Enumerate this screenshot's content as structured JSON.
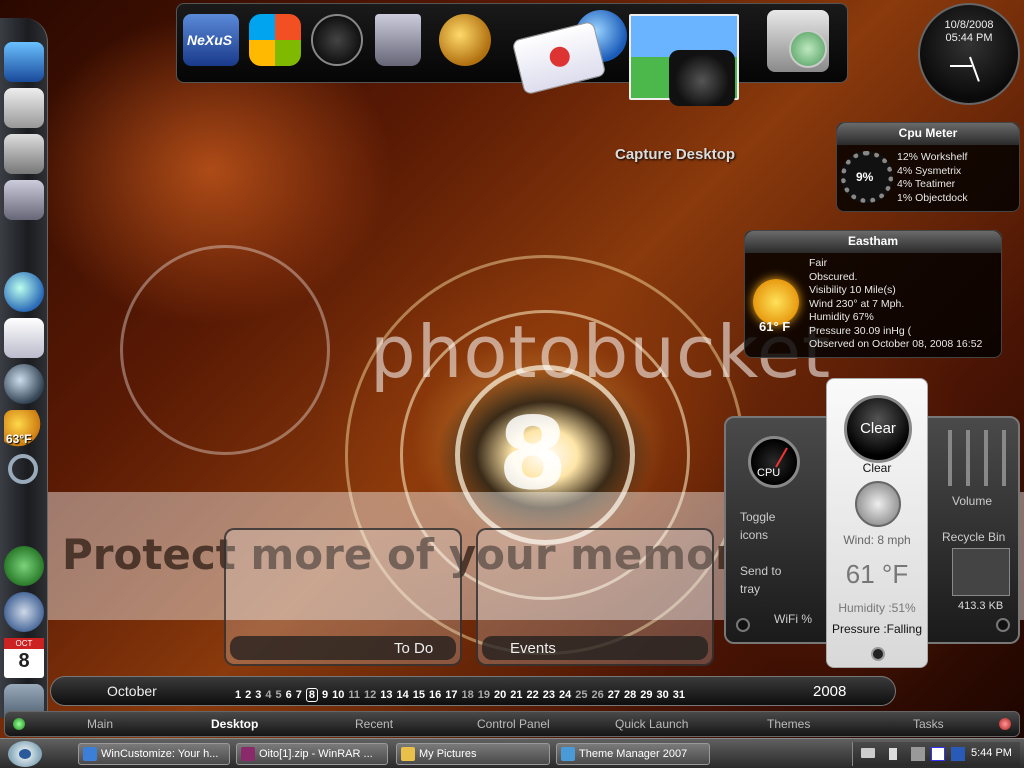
{
  "wallpaper": {
    "center_numeral": "8"
  },
  "watermark": {
    "logo": "photobucket",
    "banner": "Protect more of your memories for less!"
  },
  "top_dock": {
    "icons": [
      {
        "name": "nexus-logo-icon",
        "label": "NeXuS"
      },
      {
        "name": "windows-flag-icon"
      },
      {
        "name": "clock-icon"
      },
      {
        "name": "recycle-bin-icon"
      },
      {
        "name": "globe-network-icon"
      },
      {
        "name": "internet-explorer-icon"
      },
      {
        "name": "mail-envelope-icon"
      },
      {
        "name": "camera-capture-icon"
      },
      {
        "name": "monitor-clock-icon"
      }
    ],
    "hover_label": "Capture Desktop"
  },
  "clock": {
    "date": "10/8/2008",
    "time": "05:44 PM"
  },
  "cpu_meter": {
    "title": "Cpu Meter",
    "percent": "9%",
    "processes": [
      "12% Workshelf",
      "4% Sysmetrix",
      "4% Teatimer",
      "1% Objectdock"
    ]
  },
  "weather": {
    "title": "Eastham",
    "temp": "61° F",
    "lines": [
      "Fair",
      "Obscured.",
      "Visibility 10 Mile(s)",
      "Wind 230° at 7 Mph.",
      "Humidity 67%",
      "Pressure 30.09 inHg (",
      "Observed on October 08, 2008 16:52"
    ]
  },
  "left_dock": {
    "weather_temp": "63°F",
    "calendar_month": "OCT",
    "calendar_day": "8"
  },
  "sysmetrix": {
    "cpu_label": "CPU",
    "toggle_icons": "Toggle icons",
    "send_to_tray": "Send to tray",
    "wifi": "WiFi %",
    "volume": "Volume",
    "recycle_bin": "Recycle Bin",
    "recycle_size": "413.3 KB",
    "weather_button": "Clear",
    "weather_cond": "Clear",
    "wind": "Wind: 8 mph",
    "temp": "61 °F",
    "humidity": "Humidity :51%",
    "pressure": "Pressure :Falling"
  },
  "widgets": {
    "todo_label": "To Do",
    "events_label": "Events"
  },
  "calendar_bar": {
    "month": "October",
    "year": "2008",
    "today": "8",
    "days": [
      "1",
      "2",
      "3",
      "4",
      "5",
      "6",
      "7",
      "8",
      "9",
      "10",
      "11",
      "12",
      "13",
      "14",
      "15",
      "16",
      "17",
      "18",
      "19",
      "20",
      "21",
      "22",
      "23",
      "24",
      "25",
      "26",
      "27",
      "28",
      "29",
      "30",
      "31"
    ],
    "weekend_days": [
      "4",
      "5",
      "11",
      "12",
      "18",
      "19",
      "25",
      "26"
    ]
  },
  "menu_bar": {
    "items": [
      "Main",
      "Desktop",
      "Recent",
      "Control Panel",
      "Quick Launch",
      "Themes",
      "Tasks"
    ],
    "active": "Desktop"
  },
  "taskbar": {
    "buttons": [
      {
        "label": "WinCustomize: Your h...",
        "icon": "ie-icon",
        "color": "#3b7fd8"
      },
      {
        "label": "Oito[1].zip - WinRAR ...",
        "icon": "winrar-icon",
        "color": "#8a2a6a"
      },
      {
        "label": "My Pictures",
        "icon": "folder-icon",
        "color": "#e8c04a"
      },
      {
        "label": "Theme Manager 2007",
        "icon": "theme-manager-icon",
        "color": "#4a9ad8"
      }
    ],
    "clock": "5:44 PM"
  },
  "colors": {
    "accent_green": "#3ecf3e",
    "accent_red": "#e03030",
    "panel_bg": "#000000"
  }
}
